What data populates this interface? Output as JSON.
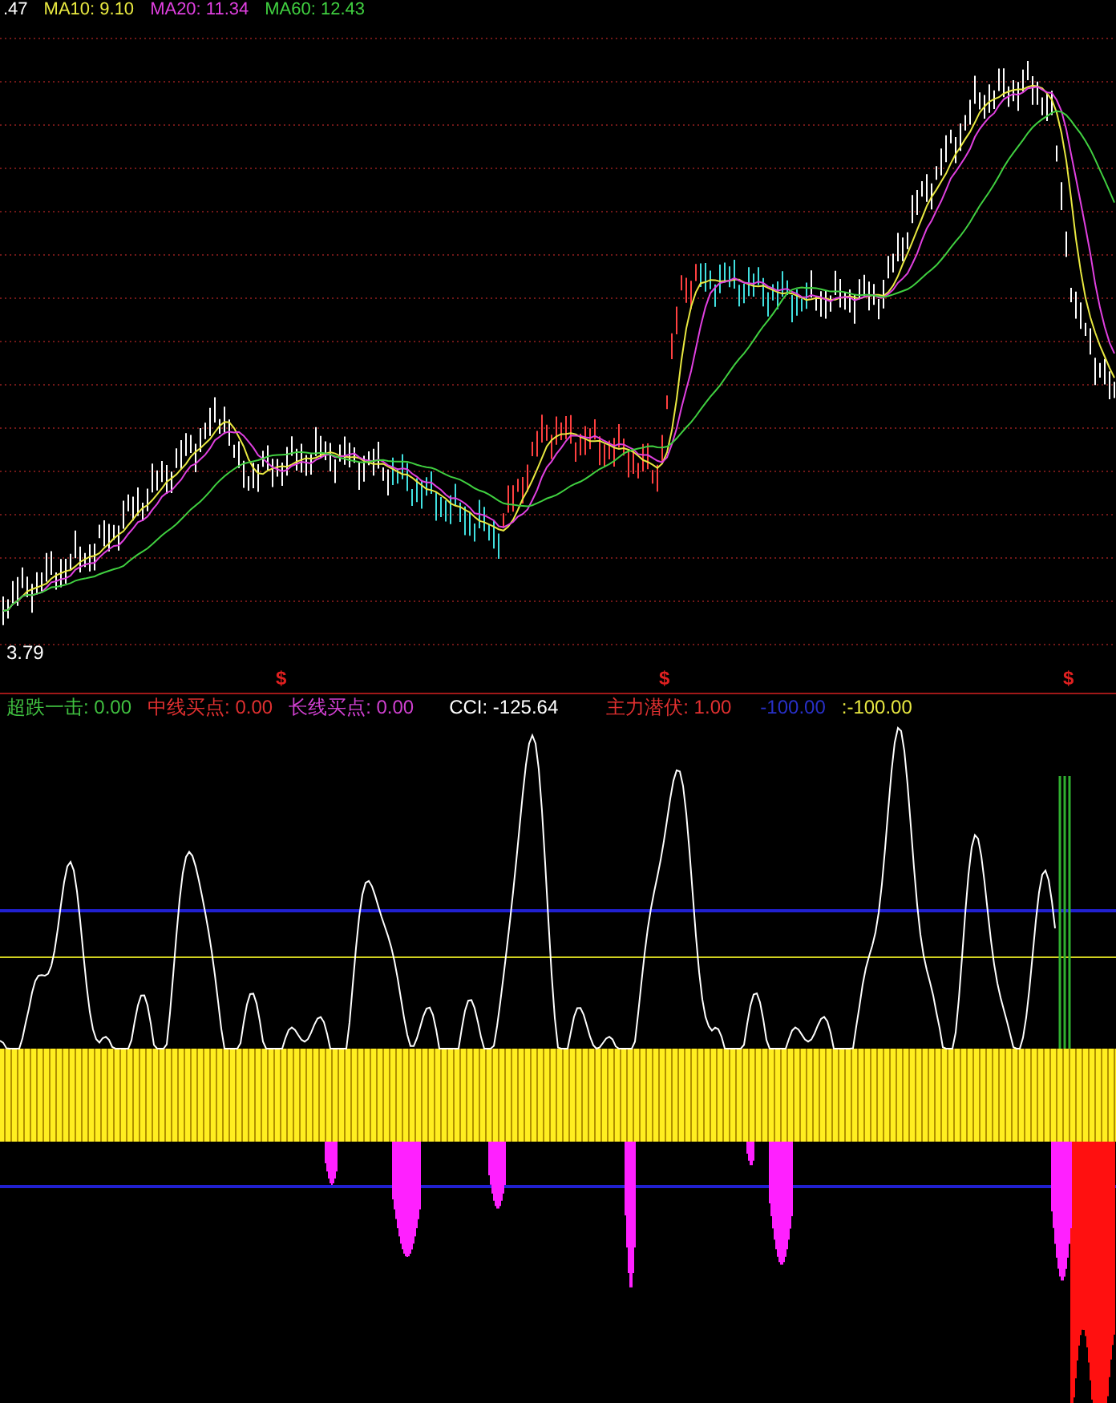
{
  "price_legend": [
    {
      "text": ".47",
      "color": "#ffffff"
    },
    {
      "text": "MA10: 9.10",
      "color": "#e8e840"
    },
    {
      "text": "MA20: 11.34",
      "color": "#e040e0"
    },
    {
      "text": "MA60: 12.43",
      "color": "#40d040"
    }
  ],
  "price_low_label": "3.79",
  "signal_markers": [
    "$",
    "$",
    "$"
  ],
  "indicator_legend": [
    {
      "label": "超跌一击:",
      "value": "0.00",
      "color": "#40c040"
    },
    {
      "label": "中线买点:",
      "value": "0.00",
      "color": "#e03030"
    },
    {
      "label": "长线买点:",
      "value": "0.00",
      "color": "#d040d0"
    },
    {
      "label": "CCI:",
      "value": "-125.64",
      "color": "#ffffff"
    },
    {
      "label": "主力潜伏:",
      "value": "1.00",
      "color": "#e03030"
    },
    {
      "label": "-100.00",
      "color": "#2830c8"
    },
    {
      "label": ":-100.00",
      "color": "#e8e840"
    }
  ]
}
